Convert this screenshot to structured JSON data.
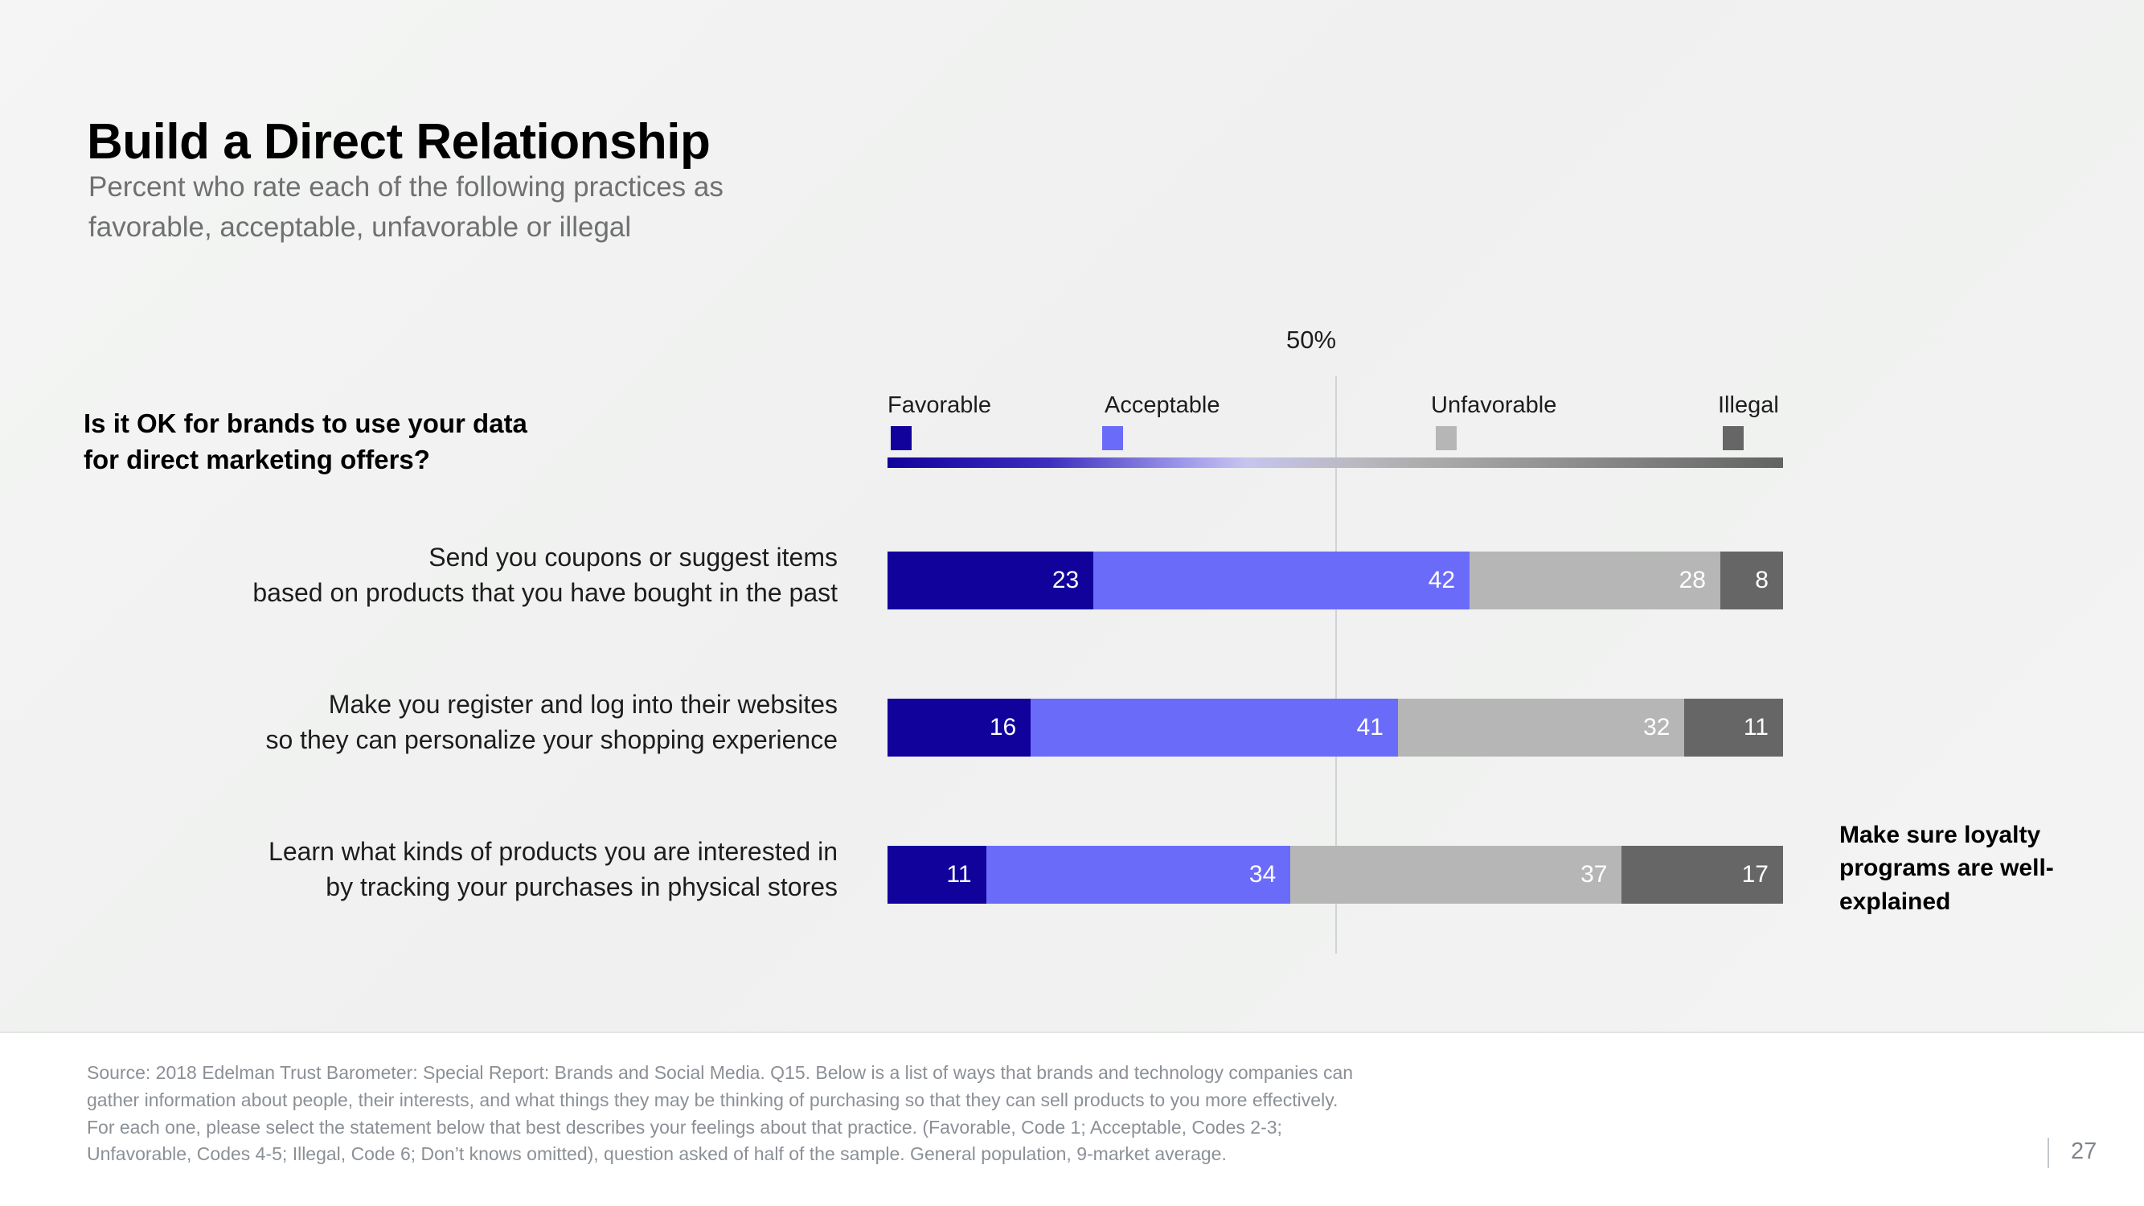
{
  "header": {
    "title": "Build a Direct Relationship",
    "subtitle_line1": "Percent who rate each of the following practices as",
    "subtitle_line2": "favorable, acceptable, unfavorable or illegal"
  },
  "question": {
    "line1": "Is it OK for brands to use your data",
    "line2": "for direct marketing offers?"
  },
  "annotation": {
    "line1": "Make sure loyalty",
    "line2": "programs are well-",
    "line3": "explained"
  },
  "axis": {
    "midpoint_label": "50%"
  },
  "legend": [
    {
      "label": "Favorable",
      "color": "#12029c"
    },
    {
      "label": "Acceptable",
      "color": "#6b6bfa"
    },
    {
      "label": "Unfavorable",
      "color": "#b6b6b6"
    },
    {
      "label": "Illegal",
      "color": "#666666"
    }
  ],
  "rows": [
    {
      "label_line1": "Send you coupons or suggest items",
      "label_line2": "based on products that you have bought in the past",
      "values": [
        23,
        42,
        28,
        8
      ]
    },
    {
      "label_line1": "Make you register and log into their websites",
      "label_line2": "so they can personalize your shopping experience",
      "values": [
        16,
        41,
        32,
        11
      ]
    },
    {
      "label_line1": "Learn what kinds of products you are interested in",
      "label_line2": "by tracking your purchases in physical stores",
      "values": [
        11,
        34,
        37,
        17
      ]
    }
  ],
  "footer": {
    "source_line1": "Source: 2018 Edelman Trust Barometer: Special Report: Brands and Social Media. Q15. Below is a list of ways that brands and technology companies can",
    "source_line2": "gather information about people, their interests, and what things they may be thinking of purchasing so that they can sell products to you more effectively.",
    "source_line3": "For each one, please select the statement below that best describes your feelings about that practice. (Favorable, Code 1; Acceptable, Codes 2-3;",
    "source_line4": "Unfavorable, Codes 4-5; Illegal, Code 6; Don’t knows omitted), question asked of half of the sample. General population, 9-market average.",
    "page_number": "27"
  },
  "chart_data": {
    "type": "bar",
    "subtype": "100% stacked horizontal",
    "title": "Build a Direct Relationship",
    "subtitle": "Percent who rate each of the following practices as favorable, acceptable, unfavorable or illegal",
    "question": "Is it OK for brands to use your data for direct marketing offers?",
    "xlabel": "",
    "ylabel": "",
    "xlim": [
      0,
      100
    ],
    "grid": false,
    "gridlines": [
      50
    ],
    "midpoint_label": "50%",
    "legend_position": "top",
    "legend_entries": [
      "Favorable",
      "Acceptable",
      "Unfavorable",
      "Illegal"
    ],
    "colors": [
      "#12029c",
      "#6b6bfa",
      "#b6b6b6",
      "#666666"
    ],
    "categories": [
      "Send you coupons or suggest items based on products that you have bought in the past",
      "Make you register and log into their websites so they can personalize your shopping experience",
      "Learn what kinds of products you are interested in by tracking your purchases in physical stores"
    ],
    "series": [
      {
        "name": "Favorable",
        "values": [
          23,
          16,
          11
        ]
      },
      {
        "name": "Acceptable",
        "values": [
          42,
          41,
          34
        ]
      },
      {
        "name": "Unfavorable",
        "values": [
          28,
          32,
          37
        ]
      },
      {
        "name": "Illegal",
        "values": [
          8,
          11,
          17
        ]
      }
    ],
    "annotation": "Make sure loyalty programs are well-explained"
  }
}
